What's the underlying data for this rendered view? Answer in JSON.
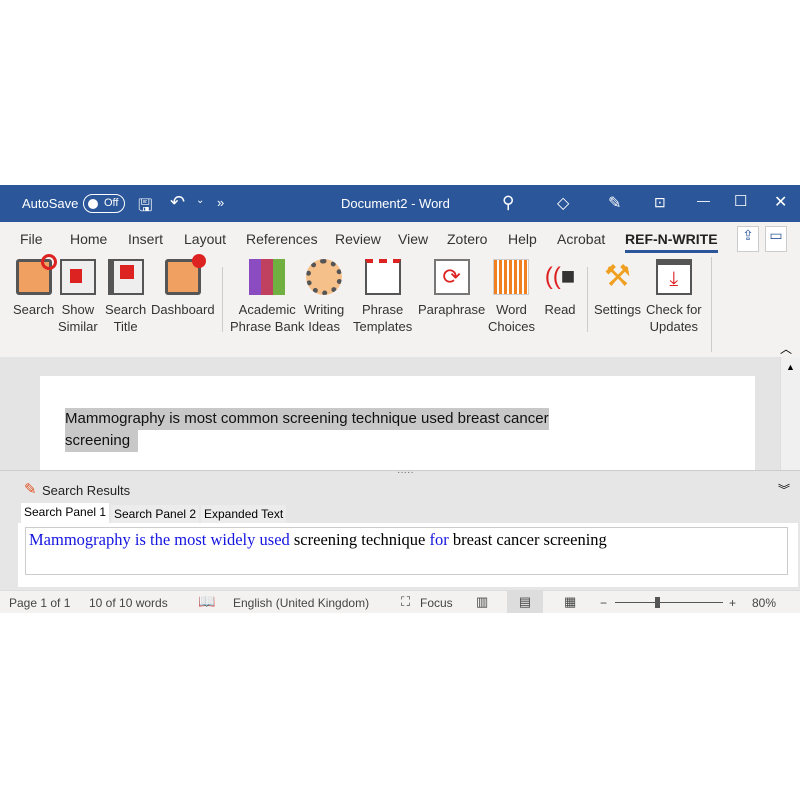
{
  "titlebar": {
    "autosave": "AutoSave",
    "toggle": "Off",
    "title": "Document2 - Word"
  },
  "tabs": [
    "File",
    "Home",
    "Insert",
    "Layout",
    "References",
    "Review",
    "View",
    "Zotero",
    "Help",
    "Acrobat",
    "REF-N-WRITE"
  ],
  "ribbon": [
    {
      "l1": "Search",
      "l2": ""
    },
    {
      "l1": "Show",
      "l2": "Similar"
    },
    {
      "l1": "Search",
      "l2": "Title"
    },
    {
      "l1": "Dashboard",
      "l2": ""
    },
    {
      "l1": "Academic",
      "l2": "Phrase Bank"
    },
    {
      "l1": "Writing",
      "l2": "Ideas"
    },
    {
      "l1": "Phrase",
      "l2": "Templates"
    },
    {
      "l1": "Paraphrase",
      "l2": ""
    },
    {
      "l1": "Word",
      "l2": "Choices"
    },
    {
      "l1": "Read",
      "l2": ""
    },
    {
      "l1": "Settings",
      "l2": ""
    },
    {
      "l1": "Check for",
      "l2": "Updates"
    }
  ],
  "document": {
    "line1": "Mammography is most common screening technique used breast cancer",
    "line2": "screening"
  },
  "panel": {
    "title": "Search Results",
    "tabs": [
      "Search Panel 1",
      "Search Panel 2",
      "Expanded Text"
    ],
    "result": [
      {
        "t": "Mammography is the most widely used",
        "hl": true
      },
      {
        "t": " screening technique ",
        "hl": false
      },
      {
        "t": "for",
        "hl": true
      },
      {
        "t": " breast cancer screening",
        "hl": false
      }
    ]
  },
  "status": {
    "page": "Page 1 of 1",
    "words": "10 of 10 words",
    "language": "English (United Kingdom)",
    "focus": "Focus",
    "zoom": "80%",
    "zoom_minus": "−",
    "zoom_plus": "+"
  },
  "colors": {
    "titlebar": "#2b579a",
    "highlight": "#1515e0"
  }
}
